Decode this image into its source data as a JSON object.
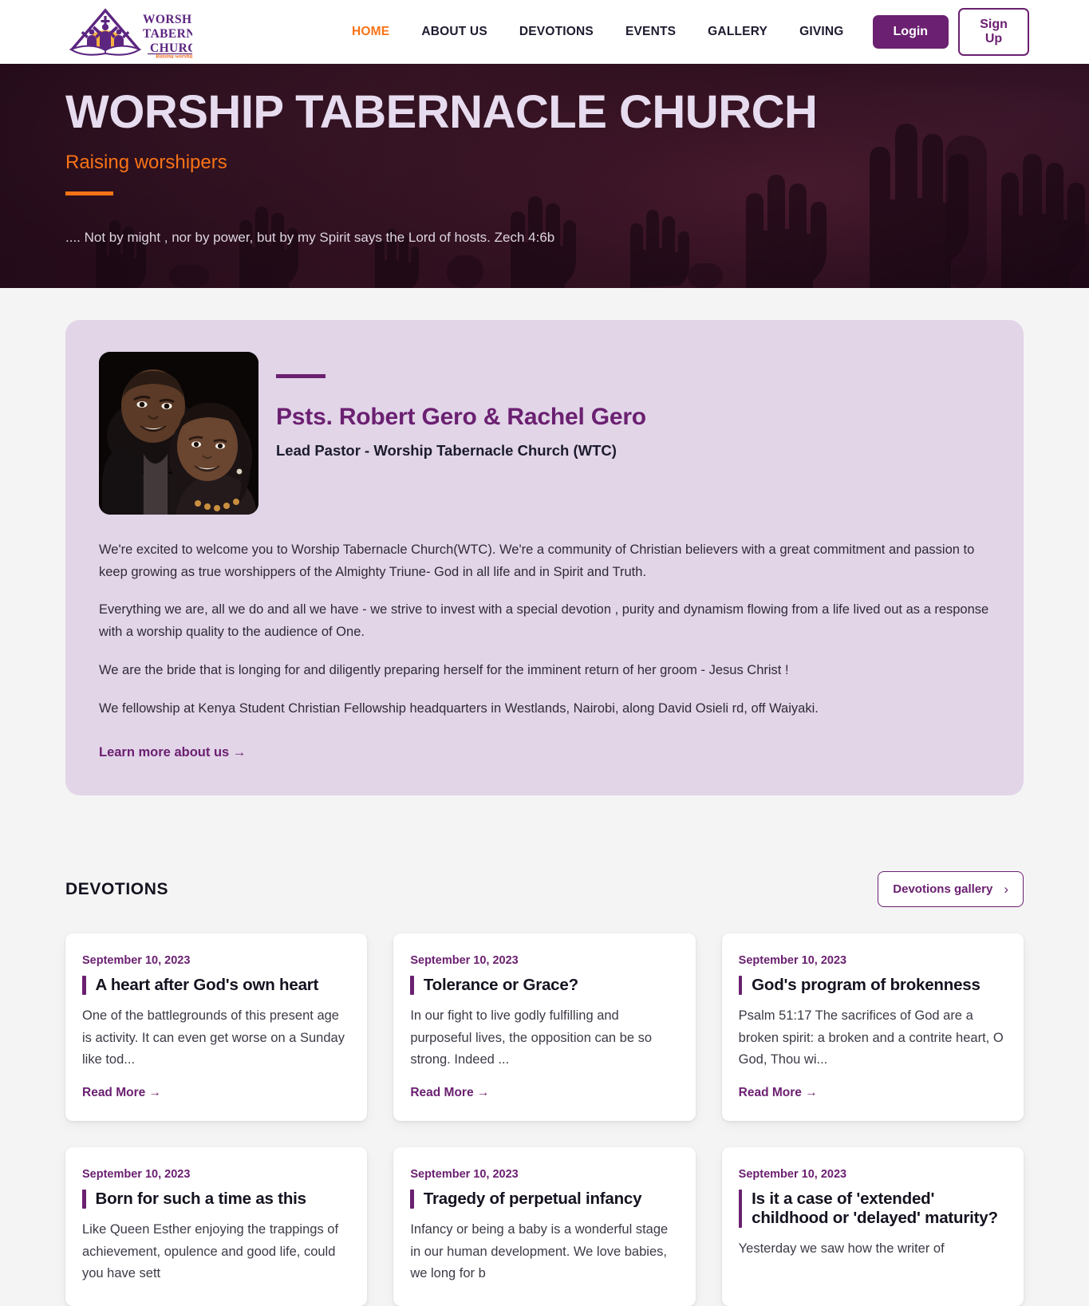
{
  "colors": {
    "brand_purple": "#6b2071",
    "accent_orange": "#f97316",
    "hero_title": "#e7dcef",
    "card_lavender": "#e2d5e8",
    "page_bg": "#f4f4f4",
    "ink": "#14121f"
  },
  "header": {
    "logo": {
      "line1": "WORSHIP",
      "line2": "TABERNACLE",
      "line3": "CHURCH",
      "tagline": "Raising worshippers",
      "icon": "church-cross-logo"
    },
    "nav": [
      {
        "label": "HOME",
        "active": true
      },
      {
        "label": "ABOUT US",
        "active": false
      },
      {
        "label": "DEVOTIONS",
        "active": false
      },
      {
        "label": "EVENTS",
        "active": false
      },
      {
        "label": "GALLERY",
        "active": false
      },
      {
        "label": "GIVING",
        "active": false
      }
    ],
    "login_label": "Login",
    "signup_label": "Sign Up"
  },
  "hero": {
    "title": "WORSHIP TABERNACLE CHURCH",
    "tagline": "Raising worshipers",
    "verse": ".... Not by might , nor by power, but by my Spirit says the Lord of hosts. Zech 4:6b"
  },
  "pastor": {
    "photo_alt": "pastor-couple-portrait",
    "name": "Psts. Robert Gero & Rachel Gero",
    "role": "Lead Pastor - Worship Tabernacle Church (WTC)",
    "paragraphs": [
      "We're excited to welcome you to Worship Tabernacle Church(WTC). We're a community of Christian believers with a great commitment and passion to keep growing as true worshippers of the Almighty Triune- God in all life and in Spirit and Truth.",
      "Everything we are, all we do and all we have - we strive to invest with a special devotion , purity and dynamism flowing from a life lived out as a response with a worship quality to the audience of One.",
      "We are the bride that is longing for and diligently preparing herself for the imminent return of her groom - Jesus Christ !",
      "We fellowship at Kenya Student Christian Fellowship headquarters in Westlands, Nairobi, along David Osieli rd, off Waiyaki."
    ],
    "learn_more_label": "Learn more about us →"
  },
  "devotions": {
    "section_title": "DEVOTIONS",
    "gallery_button_label": "Devotions gallery",
    "gallery_button_icon": "chevron-right-icon",
    "read_more_label": "Read More →",
    "cards": [
      {
        "date": "September 10, 2023",
        "title": "A heart after God's own heart",
        "excerpt": "One of the battlegrounds of this present age is activity. It can even get worse on a Sunday like tod..."
      },
      {
        "date": "September 10, 2023",
        "title": "Tolerance or Grace?",
        "excerpt": "In our fight to live godly fulfilling and purposeful lives, the opposition can be so strong. Indeed ..."
      },
      {
        "date": "September 10, 2023",
        "title": "God's program of brokenness",
        "excerpt": "Psalm 51:17 The sacrifices of God are a broken spirit: a broken and a contrite heart, O God, Thou wi..."
      },
      {
        "date": "September 10, 2023",
        "title": "Born for such a time as this",
        "excerpt": "Like Queen Esther enjoying the trappings of achievement, opulence and good life, could you have sett"
      },
      {
        "date": "September 10, 2023",
        "title": "Tragedy of perpetual infancy",
        "excerpt": "Infancy or being a baby is a wonderful stage in our human development. We love babies, we long for b"
      },
      {
        "date": "September 10, 2023",
        "title": "Is it a case of 'extended' childhood or 'delayed' maturity?",
        "excerpt": "Yesterday we saw how the writer of"
      }
    ]
  }
}
